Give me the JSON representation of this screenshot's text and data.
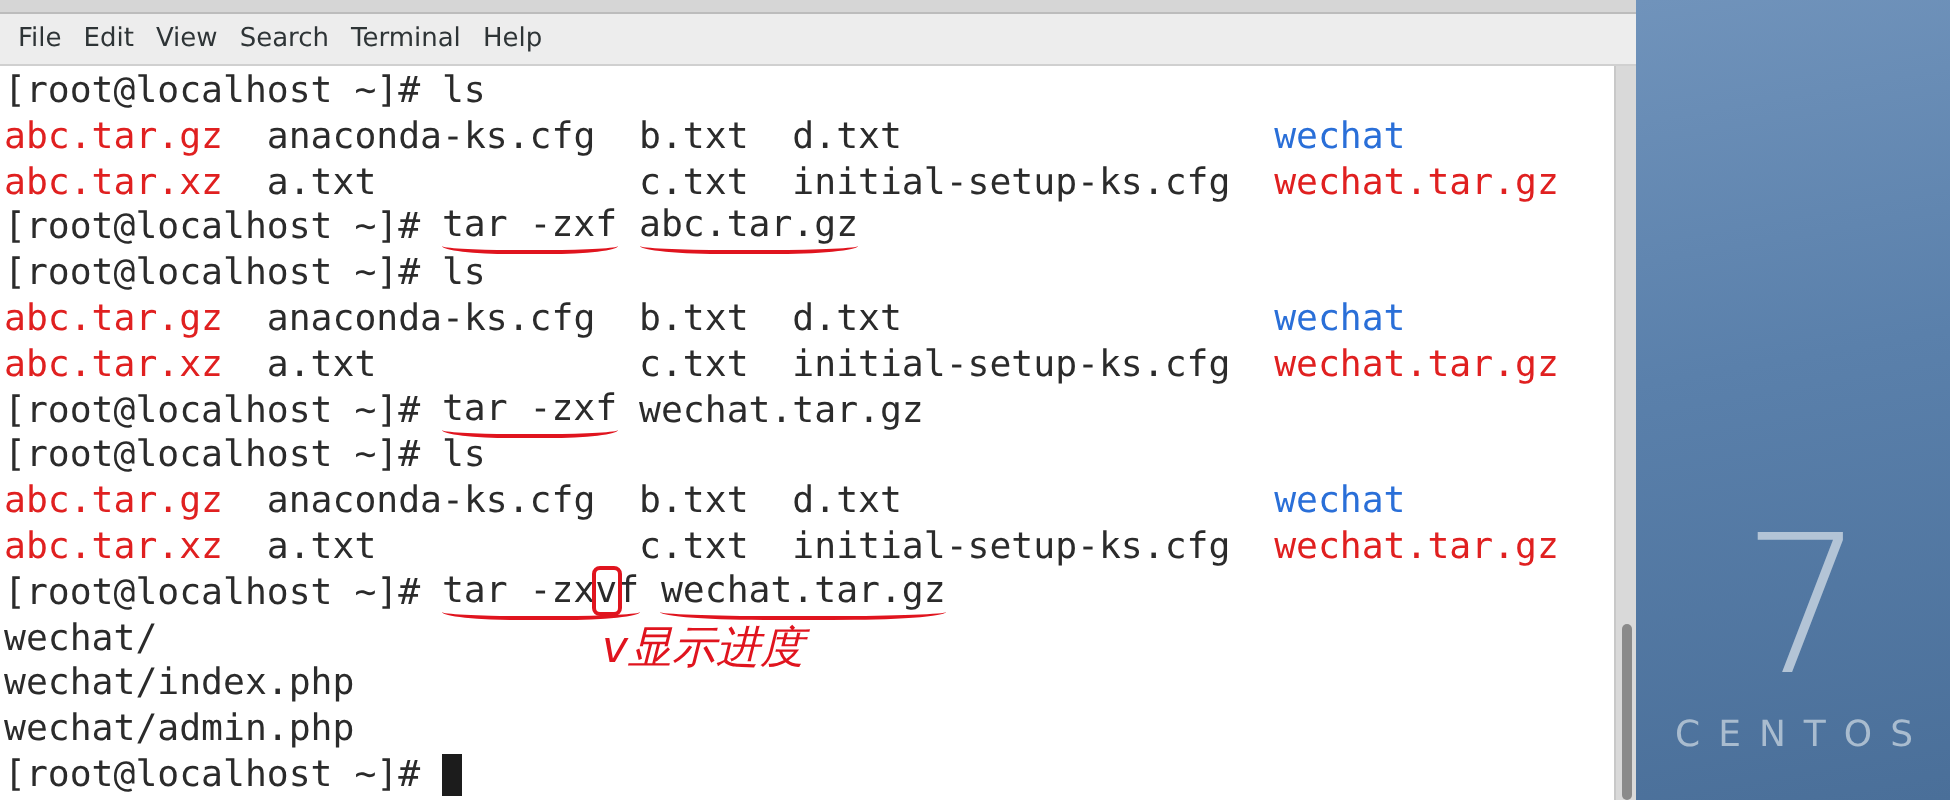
{
  "menu": [
    "File",
    "Edit",
    "View",
    "Search",
    "Terminal",
    "Help"
  ],
  "terminal": {
    "lines": [
      {
        "kind": "command",
        "prompt": "[root@localhost ~]#",
        "parts": [
          {
            "underlined": false,
            "pieces": [
              {
                "text": "ls",
                "boxed": false
              }
            ]
          }
        ]
      },
      {
        "kind": "listing",
        "files": [
          {
            "name": "abc.tar.gz",
            "color": "#e02020"
          },
          {
            "name": "anaconda-ks.cfg",
            "color": "#2b2b2b"
          },
          {
            "name": "b.txt",
            "color": "#2b2b2b"
          },
          {
            "name": "d.txt",
            "color": "#2b2b2b"
          },
          {
            "name": "wechat",
            "color": "#2a6fd8"
          }
        ]
      },
      {
        "kind": "listing",
        "files": [
          {
            "name": "abc.tar.xz",
            "color": "#e02020"
          },
          {
            "name": "a.txt",
            "color": "#2b2b2b"
          },
          {
            "name": "c.txt",
            "color": "#2b2b2b"
          },
          {
            "name": "initial-setup-ks.cfg",
            "color": "#2b2b2b"
          },
          {
            "name": "wechat.tar.gz",
            "color": "#e02020"
          }
        ]
      },
      {
        "kind": "command",
        "prompt": "[root@localhost ~]#",
        "parts": [
          {
            "underlined": true,
            "pieces": [
              {
                "text": "tar -zxf",
                "boxed": false
              }
            ]
          },
          {
            "underlined": true,
            "pieces": [
              {
                "text": "abc.tar.gz",
                "boxed": false
              }
            ]
          }
        ]
      },
      {
        "kind": "command",
        "prompt": "[root@localhost ~]#",
        "parts": [
          {
            "underlined": false,
            "pieces": [
              {
                "text": "ls",
                "boxed": false
              }
            ]
          }
        ]
      },
      {
        "kind": "listing",
        "files": [
          {
            "name": "abc.tar.gz",
            "color": "#e02020"
          },
          {
            "name": "anaconda-ks.cfg",
            "color": "#2b2b2b"
          },
          {
            "name": "b.txt",
            "color": "#2b2b2b"
          },
          {
            "name": "d.txt",
            "color": "#2b2b2b"
          },
          {
            "name": "wechat",
            "color": "#2a6fd8"
          }
        ]
      },
      {
        "kind": "listing",
        "files": [
          {
            "name": "abc.tar.xz",
            "color": "#e02020"
          },
          {
            "name": "a.txt",
            "color": "#2b2b2b"
          },
          {
            "name": "c.txt",
            "color": "#2b2b2b"
          },
          {
            "name": "initial-setup-ks.cfg",
            "color": "#2b2b2b"
          },
          {
            "name": "wechat.tar.gz",
            "color": "#e02020"
          }
        ]
      },
      {
        "kind": "command",
        "prompt": "[root@localhost ~]#",
        "parts": [
          {
            "underlined": true,
            "pieces": [
              {
                "text": "tar -zxf",
                "boxed": false
              }
            ]
          },
          {
            "underlined": false,
            "pieces": [
              {
                "text": "wechat.tar.gz",
                "boxed": false
              }
            ]
          }
        ]
      },
      {
        "kind": "command",
        "prompt": "[root@localhost ~]#",
        "parts": [
          {
            "underlined": false,
            "pieces": [
              {
                "text": "ls",
                "boxed": false
              }
            ]
          }
        ]
      },
      {
        "kind": "listing",
        "files": [
          {
            "name": "abc.tar.gz",
            "color": "#e02020"
          },
          {
            "name": "anaconda-ks.cfg",
            "color": "#2b2b2b"
          },
          {
            "name": "b.txt",
            "color": "#2b2b2b"
          },
          {
            "name": "d.txt",
            "color": "#2b2b2b"
          },
          {
            "name": "wechat",
            "color": "#2a6fd8"
          }
        ]
      },
      {
        "kind": "listing",
        "files": [
          {
            "name": "abc.tar.xz",
            "color": "#e02020"
          },
          {
            "name": "a.txt",
            "color": "#2b2b2b"
          },
          {
            "name": "c.txt",
            "color": "#2b2b2b"
          },
          {
            "name": "initial-setup-ks.cfg",
            "color": "#2b2b2b"
          },
          {
            "name": "wechat.tar.gz",
            "color": "#e02020"
          }
        ]
      },
      {
        "kind": "command",
        "prompt": "[root@localhost ~]#",
        "parts": [
          {
            "underlined": true,
            "pieces": [
              {
                "text": "tar -zx",
                "boxed": false
              },
              {
                "text": "v",
                "boxed": true
              },
              {
                "text": "f",
                "boxed": false
              }
            ]
          },
          {
            "underlined": true,
            "pieces": [
              {
                "text": "wechat.tar.gz",
                "boxed": false
              }
            ]
          }
        ],
        "annotation": "v显示进度"
      },
      {
        "kind": "output",
        "text": "wechat/"
      },
      {
        "kind": "output",
        "text": "wechat/index.php"
      },
      {
        "kind": "output",
        "text": "wechat/admin.php"
      },
      {
        "kind": "prompt",
        "prompt": "[root@localhost ~]#"
      }
    ]
  },
  "desktop": {
    "logo_number": "7",
    "logo_word": "CENTOS"
  }
}
